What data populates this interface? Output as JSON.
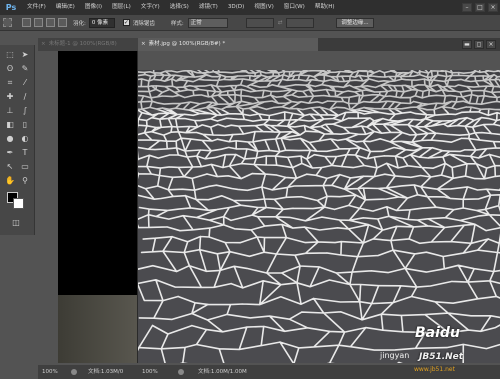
{
  "app": {
    "logo": "Ps"
  },
  "menu": [
    "文件(F)",
    "编辑(E)",
    "图像(I)",
    "图层(L)",
    "文字(Y)",
    "选择(S)",
    "滤镜(T)",
    "3D(D)",
    "视图(V)",
    "窗口(W)",
    "帮助(H)"
  ],
  "window_controls": {
    "minimize": "–",
    "restore": "□",
    "close": "×"
  },
  "options": {
    "feather_label": "羽化:",
    "feather_value": "0 像素",
    "antialias_label": "消除锯齿",
    "style_label": "样式:",
    "style_value": "正常",
    "refine_button": "调整边缘..."
  },
  "tabs": [
    {
      "label": "未标题-1 @ 100%(RGB/8)",
      "close": "×",
      "active": false
    },
    {
      "label": "素材.jpg @ 100%(RGB/8#) *",
      "close": "×",
      "active": true
    }
  ],
  "doc_controls": {
    "minimize": "▬",
    "restore": "◻",
    "close": "×"
  },
  "status": [
    {
      "zoom": "100%",
      "doc": "文档:1.03M/0"
    },
    {
      "zoom": "100%",
      "doc": "文档:1.00M/1.00M"
    }
  ],
  "watermarks": {
    "jingyan": "jingyan",
    "logo": "Baidu",
    "site": "JB51.Net",
    "url": "www.jb51.net"
  },
  "colors": {
    "foreground": "#000000",
    "background": "#ffffff",
    "accent": "#6fb6f0"
  }
}
